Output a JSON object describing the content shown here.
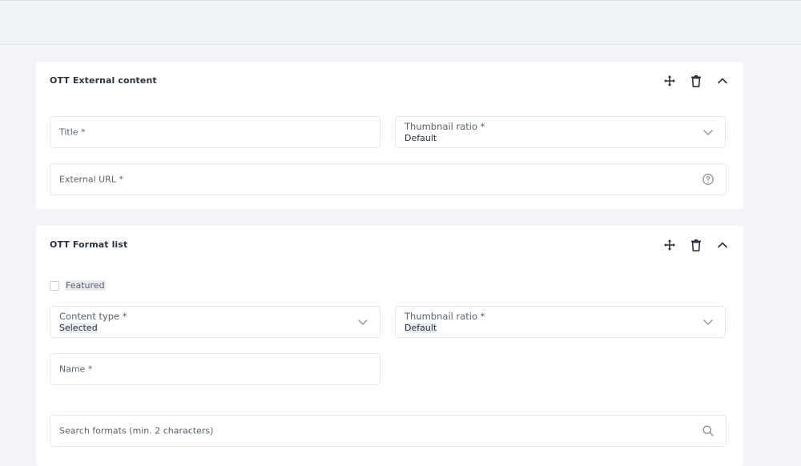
{
  "cards": [
    {
      "title": "OTT External content",
      "fields": {
        "title": {
          "label": "Title *"
        },
        "thumbnail_ratio": {
          "label": "Thumbnail ratio *",
          "value": "Default"
        },
        "external_url": {
          "label": "External URL *"
        }
      }
    },
    {
      "title": "OTT Format list",
      "featured": {
        "label": "Featured",
        "checked": false
      },
      "fields": {
        "content_type": {
          "label": "Content type *",
          "value": "Selected"
        },
        "thumbnail_ratio": {
          "label": "Thumbnail ratio *",
          "value": "Default"
        },
        "name": {
          "label": "Name *"
        },
        "search": {
          "placeholder": "Search formats (min. 2 characters)"
        }
      }
    }
  ],
  "icons": {
    "move": "move-icon",
    "delete": "trash-icon",
    "collapse": "chevron-up-icon",
    "dropdown": "chevron-down-icon",
    "help": "help-circle-icon",
    "search": "search-icon"
  },
  "colors": {
    "background": "#f2f4f7",
    "card": "#ffffff",
    "border": "#e6e9ee",
    "text": "#2b3340",
    "muted": "#5a6270",
    "highlight": "#e8ecef"
  }
}
